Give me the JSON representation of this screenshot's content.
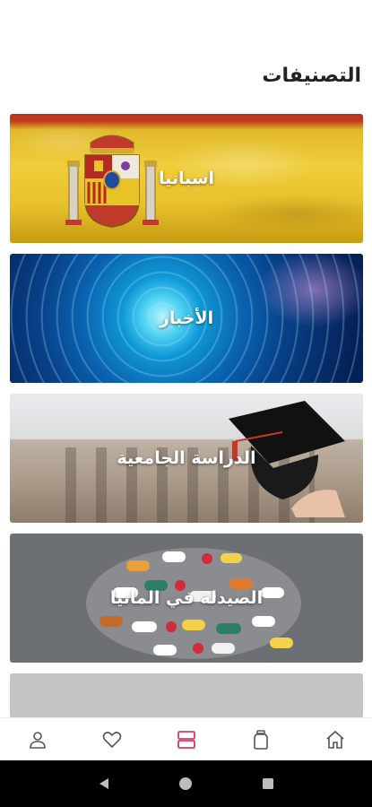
{
  "header": {
    "title": "التصنيفات"
  },
  "categories": [
    {
      "label": "اسبانيا"
    },
    {
      "label": "الأخبار"
    },
    {
      "label": "الدراسة الجامعية"
    },
    {
      "label": "الصيدلة في المانيا"
    }
  ],
  "bottom_nav": {
    "items": [
      {
        "icon": "profile-icon",
        "active": false
      },
      {
        "icon": "heart-icon",
        "active": false
      },
      {
        "icon": "categories-icon",
        "active": true
      },
      {
        "icon": "jar-icon",
        "active": false
      },
      {
        "icon": "home-icon",
        "active": false
      }
    ],
    "active_color": "#e0336a",
    "inactive_color": "#555555"
  },
  "system_nav": {
    "buttons": [
      "back-icon",
      "home-circle-icon",
      "recents-icon"
    ]
  }
}
